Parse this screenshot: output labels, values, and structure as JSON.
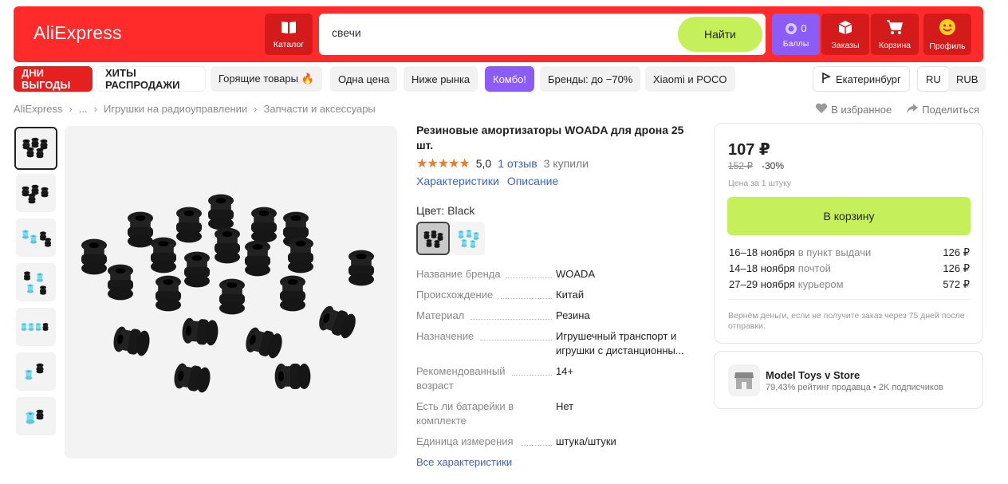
{
  "header": {
    "logo": "AliExpress",
    "catalog": "Каталог",
    "search_value": "свечи",
    "search_button": "Найти",
    "points_count": "0",
    "points_label": "Баллы",
    "orders_label": "Заказы",
    "cart_label": "Корзина",
    "profile_label": "Профиль"
  },
  "chips": {
    "dni": "ДНИ ВЫГОДЫ",
    "hity": "ХИТЫ РАСПРОДАЖИ",
    "hot": "Горящие товары 🔥",
    "one_price": "Одна цена",
    "below_market": "Ниже рынка",
    "combo": "Комбо!",
    "brands": "Бренды: до −70%",
    "xiaomi": "Xiaomi и POCO",
    "city": "Екатеринбург",
    "lang": "RU",
    "currency": "RUB"
  },
  "breadcrumb": [
    "AliExpress",
    "...",
    "Игрушки на радиоуправлении",
    "Запчасти и аксессуары"
  ],
  "actions": {
    "favorite": "В избранное",
    "share": "Поделиться"
  },
  "product": {
    "title": "Резиновые амортизаторы WOADA для дрона 25 шт.",
    "rating": "5,0",
    "reviews": "1 отзыв",
    "bought": "3 купили",
    "tab_specs": "Характеристики",
    "tab_desc": "Описание",
    "color_label": "Цвет: Black",
    "specs": [
      {
        "k": "Название бренда",
        "v": "WOADA"
      },
      {
        "k": "Происхождение",
        "v": "Китай"
      },
      {
        "k": "Материал",
        "v": "Резина"
      },
      {
        "k": "Назначение",
        "v": "Игрушечный транспорт и игрушки с дистанционны..."
      },
      {
        "k": "Рекомендованный возраст",
        "v": "14+"
      },
      {
        "k": "Есть ли батарейки в комплекте",
        "v": "Нет"
      },
      {
        "k": "Единица измерения",
        "v": "штука/штуки"
      }
    ],
    "all_specs": "Все характеристики"
  },
  "buy": {
    "price": "107 ₽",
    "old_price": "152 ₽",
    "discount": "-30%",
    "unit": "Цена за 1 штуку",
    "cart_button": "В корзину",
    "delivery": [
      {
        "date": "16–18 ноября",
        "method": "в пункт выдачи",
        "price": "126 ₽"
      },
      {
        "date": "14–18 ноября",
        "method": "почтой",
        "price": "126 ₽"
      },
      {
        "date": "27–29 ноября",
        "method": "курьером",
        "price": "572 ₽"
      }
    ],
    "refund": "Вернём деньги, если не получите заказ через 75 дней после отправки."
  },
  "seller": {
    "name": "Model Toys v Store",
    "rating": "79,43% рейтинг продавца",
    "subs": "2K подписчиков"
  }
}
